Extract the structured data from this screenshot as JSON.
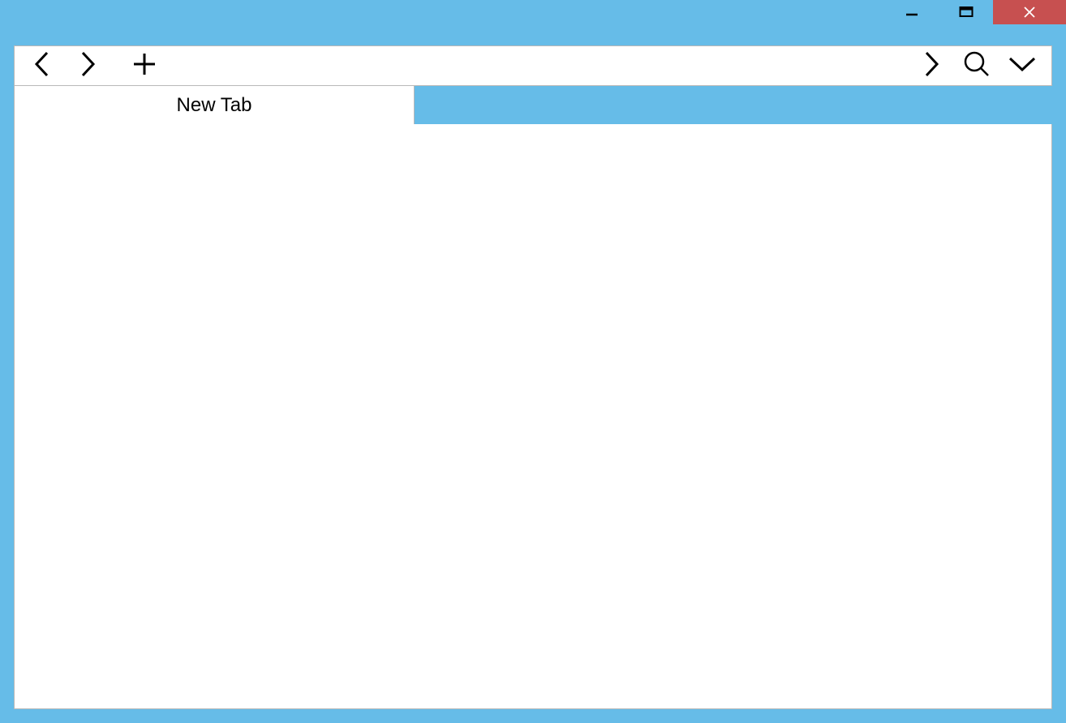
{
  "tabs": [
    {
      "label": "New Tab",
      "active": true
    }
  ]
}
